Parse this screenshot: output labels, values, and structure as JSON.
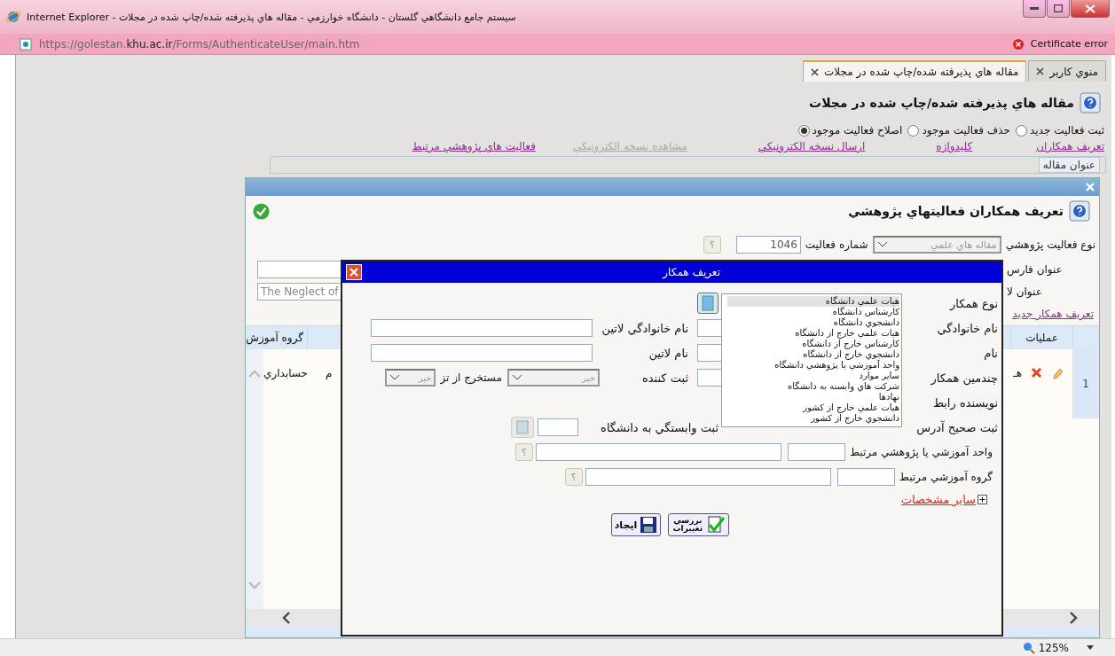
{
  "window": {
    "title": "سيستم جامع دانشگاهي گلستان - دانشگاه خوارزمي - مقاله هاي پذيرفته شده/چاپ شده در مجلات - Internet Explorer",
    "address": "https://golestan.**khu.ac.ir**/Forms/AuthenticateUser/main.htm",
    "certificate_error": "Certificate error"
  },
  "tabs": [
    {
      "label": "منوي كاربر",
      "selected": false
    },
    {
      "label": "مقاله هاي پذيرفته شده/چاپ شده در مجلات",
      "selected": true
    }
  ],
  "page": {
    "title": "مقاله هاي پذيرفته شده/چاپ شده در مجلات",
    "modes": [
      {
        "label": "ثبت فعاليت جديد",
        "selected": false
      },
      {
        "label": "حذف فعاليت موجود",
        "selected": false
      },
      {
        "label": "اصلاح فعاليت موجود",
        "selected": true
      }
    ],
    "links": [
      {
        "label": "تعريف همكاران",
        "disabled": false
      },
      {
        "label": "كليدواژه",
        "disabled": false
      },
      {
        "label": "ارسال نسخه الكترونيكي",
        "disabled": false
      },
      {
        "label": "مشاهده نسخه الكترونيكي",
        "disabled": true
      },
      {
        "label": "فعاليت هاي پژوهشي مرتبط",
        "disabled": false
      }
    ],
    "section_tab": "عنوان مقاله"
  },
  "activity_dialog": {
    "title": "تعريف همكاران فعاليتهاي پژوهشي",
    "activity_type_label": "نوع فعاليت پژوهشي",
    "activity_type_value": "مقاله هاي علمي",
    "activity_number_label": "شماره فعاليت",
    "activity_number": "1046",
    "help": "؟",
    "persian_title_label": "عنوان فارس",
    "latin_title_label": "عنوان لا",
    "latin_title_value": "The Neglect of",
    "new_colleague_link": "تعريف همكار جديد",
    "table": {
      "columns": [
        "عمليات",
        "گروه آموزش"
      ],
      "rows": [
        {
          "index": "1",
          "column_3": "هـ",
          "column_4": "م",
          "group": "حسابداري"
        }
      ]
    }
  },
  "colleague_dialog": {
    "title": "تعريف همكار",
    "rows": [
      {
        "kind": "type",
        "label": "نوع همكار"
      },
      {
        "kind": "latin",
        "label": "نام خانوادگي",
        "latin_label": "نام خانوادگي لاتين"
      },
      {
        "kind": "latin",
        "label": "نام",
        "latin_label": "نام لاتين"
      },
      {
        "kind": "flags",
        "label": "چندمين همكار",
        "registrar_label": "ثبت كننده",
        "registrar_value": "خير",
        "thesis_label": "مستخرج از تز",
        "thesis_value": "خير"
      },
      {
        "kind": "blank",
        "label": "نويسنده رابط"
      },
      {
        "kind": "affiliation",
        "label": "ثبت صحيح آدرس",
        "affiliation_label": "ثبت وابستگي به دانشگاه"
      },
      {
        "kind": "lookup",
        "label": "واحد آموزشي يا پژوهشي مرتبط",
        "help": "؟"
      },
      {
        "kind": "lookup",
        "label": "گروه آموزشي مرتبط",
        "help": "؟"
      }
    ],
    "more_link": "ساير مشخصات",
    "buttons": [
      {
        "kind": "review",
        "label": "بررسي تغييرات"
      },
      {
        "kind": "create",
        "label": "ايجاد"
      }
    ],
    "dropdown": [
      {
        "label": "هيات علمي دانشگاه",
        "selected": true
      },
      {
        "label": "كارشناس دانشگاه",
        "selected": false
      },
      {
        "label": "دانشجوي دانشگاه",
        "selected": false
      },
      {
        "label": "هيات علمي خارج از دانشگاه",
        "selected": false
      },
      {
        "label": "كارشناس خارج از دانشگاه",
        "selected": false
      },
      {
        "label": "دانشجوي خارج از دانشگاه",
        "selected": false
      },
      {
        "label": "واحد آموزشي يا پژوهشي دانشگاه",
        "selected": false
      },
      {
        "label": "ساير موارد",
        "selected": false
      },
      {
        "label": "شركت هاي وابسته به دانشگاه",
        "selected": false
      },
      {
        "label": "نهادها",
        "selected": false
      },
      {
        "label": "هيات علمي خارج از كشور",
        "selected": false
      },
      {
        "label": "دانشجوي خارج از كشور",
        "selected": false
      }
    ]
  },
  "status_bar": {
    "zoom": "125%"
  }
}
